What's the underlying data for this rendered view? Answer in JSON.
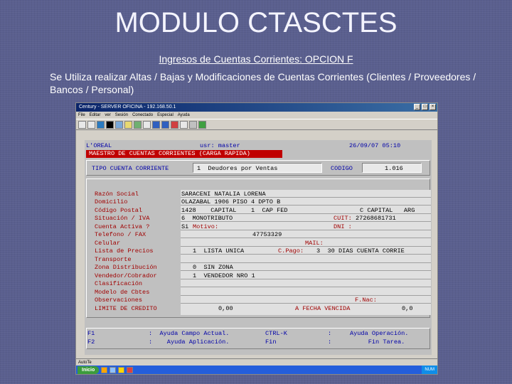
{
  "slide": {
    "title": "MODULO CTASCTES",
    "subtitle": "Ingresos de Cuentas Corrientes:  OPCION F",
    "description": "Se Utiliza realizar Altas / Bajas y Modificaciones de Cuentas Corrientes (Clientes / Proveedores / Bancos / Personal)"
  },
  "window": {
    "title": "Century - SERVER OFICINA - 192.168.50.1",
    "menu": [
      "File",
      "Editar",
      "ver",
      "Sesión",
      "Conectado",
      "Especial",
      "Ayuda"
    ],
    "status": "AutoTe",
    "taskbar_start": "Inicio",
    "tray_text": "NUM"
  },
  "app": {
    "company": "L'OREAL",
    "user": "usr: master",
    "datetime": "26/09/07 05:10",
    "screen_title": "MAESTRO DE CUENTAS CORRIENTES (CARGA RAPIDA)",
    "tipo_label": "TIPO CUENTA CORRIENTE",
    "tipo_value": "1  Deudores por Ventas",
    "codigo_label": "CODIGO",
    "codigo_value": "1.016",
    "labels": [
      "Razón Social",
      "Domicilio",
      "Código Postal",
      "Situación / IVA",
      "Cuenta Activa ?",
      "Telefono / FAX",
      "Celular",
      "Lista de Precios",
      "Transporte",
      "Zona Distribución",
      "Vendedor/Cobrador",
      "Clasificación",
      "Modelo de Cbtes",
      "Observaciones",
      "LIMITE DE CREDITO"
    ],
    "razon_social": "SARACENI NATALIA LORENA",
    "domicilio": "OLAZABAL 1906 PISO 4 DPTO B",
    "codigo_postal": "1428    CAPITAL    1  CAP FED",
    "provincia": "C CAPITAL   ARG",
    "situacion": "6  MONOTRIBUTO",
    "cuit_label": "CUIT:",
    "cuit_value": "27268681731",
    "activa": "Si",
    "motivo_label": "Motivo:",
    "dni_label": "DNI :",
    "telefono": "47753329",
    "mail_label": "MAIL:",
    "lista_precios": "1  LISTA UNICA",
    "cpago_label": "C.Pago:",
    "cpago_value": "3  30 DIAS CUENTA CORRIE",
    "zona": "0  SIN ZONA",
    "vendedor": "1  VENDEDOR NRO 1",
    "fnac_label": "F.Nac:",
    "limite": "0,00",
    "fecha_vencida_label": "A FECHA VENCIDA",
    "fecha_vencida_value": "0,0",
    "help": {
      "f1_key": "F1",
      "f1_text": ":  Ayuda Campo Actual.",
      "f2_key": "F2",
      "f2_text": ":    Ayuda Aplicación.",
      "ctrlk_key": "CTRL-K",
      "ctrlk_text": ":     Ayuda Operación.",
      "fin_key": "Fin",
      "fin_text": ":          Fin Tarea."
    }
  }
}
